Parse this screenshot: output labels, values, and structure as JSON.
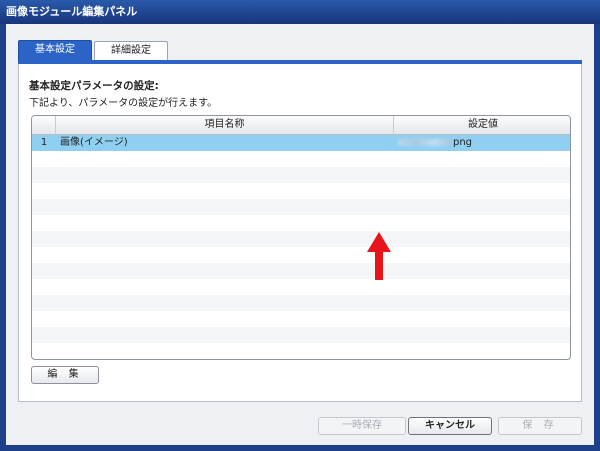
{
  "window": {
    "title": "画像モジュール編集パネル"
  },
  "tabs": [
    {
      "label": "基本設定",
      "active": true
    },
    {
      "label": "詳細設定",
      "active": false
    }
  ],
  "section": {
    "title": "基本設定パラメータの設定:",
    "description": "下記より、パラメータの設定が行えます。"
  },
  "grid": {
    "columns": [
      "項目名称",
      "設定値"
    ],
    "rows": [
      {
        "num": "1",
        "name": "画像(イメージ)",
        "value": "png",
        "selected": true
      }
    ]
  },
  "buttons": {
    "edit": "編 集",
    "temp_save": "一時保存",
    "cancel": "キャンセル",
    "save": "保 存"
  },
  "colors": {
    "accent": "#2b64c6",
    "selected_row": "#8fd0f2",
    "arrow": "#e8141a"
  },
  "annotation": {
    "icon": "arrow-up-icon"
  }
}
